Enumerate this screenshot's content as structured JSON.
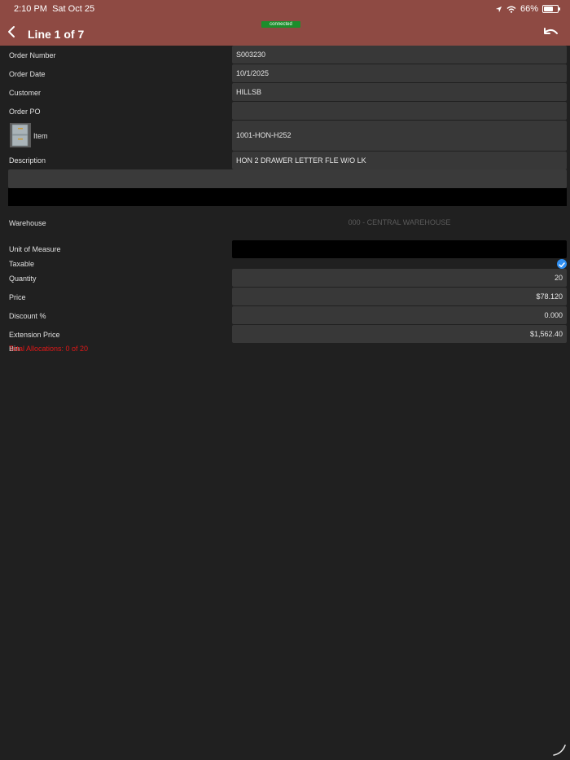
{
  "status_bar": {
    "time": "2:10 PM",
    "date": "Sat Oct 25",
    "battery": "66%",
    "battery_level": 0.66
  },
  "header": {
    "connection_status": "connected",
    "title": "Line 1 of 7",
    "back_icon": "chevron-left-icon",
    "undo_icon": "undo-icon"
  },
  "form": {
    "order_number": {
      "label": "Order Number",
      "value": "S003230"
    },
    "order_date": {
      "label": "Order Date",
      "value": "10/1/2025"
    },
    "customer": {
      "label": "Customer",
      "value": "HILLSB"
    },
    "order_po": {
      "label": "Order PO",
      "value": ""
    },
    "item": {
      "label": "Item",
      "value": "1001-HON-H252"
    },
    "description": {
      "label": "Description",
      "value": "HON 2 DRAWER LETTER FLE W/O LK"
    },
    "warehouse": {
      "label": "Warehouse",
      "value": "000 - CENTRAL WAREHOUSE"
    },
    "unit_of_measure": {
      "label": "Unit of Measure",
      "value": ""
    },
    "taxable": {
      "label": "Taxable",
      "checked": true
    },
    "quantity": {
      "label": "Quantity",
      "value": "20"
    },
    "price": {
      "label": "Price",
      "value": "$78.120"
    },
    "discount": {
      "label": "Discount %",
      "value": "0.000"
    },
    "extension_price": {
      "label": "Extension Price",
      "value": "$1,562.40"
    },
    "bin_label": "Bin",
    "allocations": "Total Allocations: 0 of 20"
  },
  "colors": {
    "header": "#8e4a43",
    "background": "#202020",
    "connected": "#1b8e2b",
    "allocations_text": "#e01818",
    "checkbox": "#2f8ef0"
  }
}
